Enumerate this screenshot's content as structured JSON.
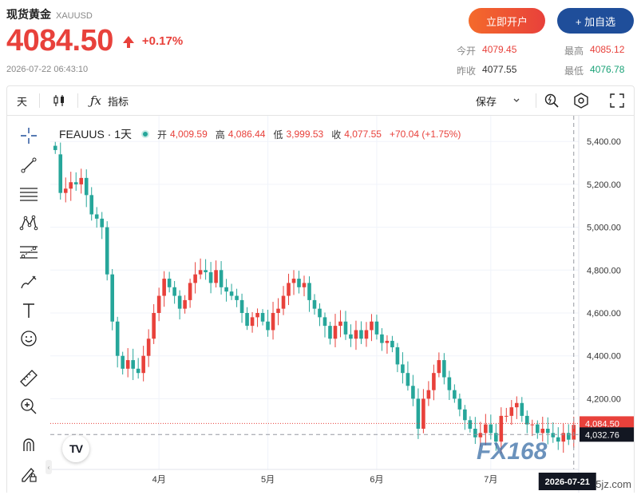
{
  "header": {
    "title": "现货黄金",
    "symbol": "XAUUSD",
    "price": "4084.50",
    "change": "+0.17%",
    "timestamp": "2026-07-22 06:43:10",
    "btn_open": "立即开户",
    "btn_watch": "+ 加自选"
  },
  "stats": {
    "open_label": "今开",
    "open_value": "4079.45",
    "high_label": "最高",
    "high_value": "4085.12",
    "prev_label": "昨收",
    "prev_value": "4077.55",
    "low_label": "最低",
    "low_value": "4076.78"
  },
  "toolbar": {
    "interval": "天",
    "indicators": "指标",
    "save": "保存"
  },
  "legend": {
    "symbol": "FEAUUS · 1天",
    "open_k": "开",
    "open_v": "4,009.59",
    "high_k": "高",
    "high_v": "4,086.44",
    "low_k": "低",
    "low_v": "3,999.53",
    "close_k": "收",
    "close_v": "4,077.55",
    "change_v": "+70.04 (+1.75%)"
  },
  "watermark": {
    "brand": "FX168",
    "url": "www.365jz.com"
  },
  "colors": {
    "up": "#e8413b",
    "down": "#26a69a",
    "accent_blue": "#1f4e9a"
  },
  "chart_data": {
    "type": "candlestick",
    "y_ticks": [
      "5,400.00",
      "5,200.00",
      "5,000.00",
      "4,800.00",
      "4,600.00",
      "4,400.00",
      "4,200.00"
    ],
    "y_tick_values": [
      5400,
      5200,
      5000,
      4800,
      4600,
      4400,
      4200
    ],
    "ylim": [
      3870,
      5520
    ],
    "x_ticks": [
      "4月",
      "5月",
      "6月",
      "7月"
    ],
    "x_tick_index": [
      20,
      41,
      62,
      84
    ],
    "last_price_label": "4,084.50",
    "last_price": 4084.5,
    "crosshair_price_label": "4,032.76",
    "crosshair_price": 4032.76,
    "crosshair_date_label": "2026-07-21",
    "crosshair_index": 100,
    "closes": [
      5360,
      5160,
      5180,
      5210,
      5200,
      5230,
      5150,
      5060,
      5040,
      5000,
      4780,
      4560,
      4400,
      4340,
      4380,
      4340,
      4320,
      4400,
      4480,
      4600,
      4680,
      4760,
      4720,
      4680,
      4620,
      4660,
      4740,
      4780,
      4800,
      4790,
      4740,
      4800,
      4720,
      4700,
      4680,
      4660,
      4600,
      4540,
      4580,
      4600,
      4560,
      4520,
      4600,
      4620,
      4680,
      4740,
      4760,
      4720,
      4740,
      4660,
      4620,
      4580,
      4540,
      4480,
      4540,
      4560,
      4500,
      4480,
      4520,
      4480,
      4520,
      4560,
      4500,
      4460,
      4470,
      4440,
      4360,
      4320,
      4260,
      4200,
      4060,
      4200,
      4240,
      4320,
      4380,
      4300,
      4240,
      4200,
      4150,
      4100,
      4060,
      4020,
      4040,
      4080,
      4040,
      4000,
      4120,
      4120,
      4160,
      4180,
      4120,
      4080,
      4080,
      4040,
      4060,
      4040,
      4020,
      4000,
      4040,
      4009,
      4078
    ],
    "opens": [
      5380,
      5340,
      5160,
      5180,
      5210,
      5200,
      5230,
      5150,
      5060,
      5040,
      5000,
      4780,
      4560,
      4400,
      4340,
      4380,
      4340,
      4320,
      4400,
      4480,
      4600,
      4680,
      4760,
      4720,
      4680,
      4620,
      4660,
      4740,
      4780,
      4800,
      4790,
      4740,
      4800,
      4720,
      4700,
      4680,
      4660,
      4600,
      4540,
      4580,
      4600,
      4560,
      4520,
      4600,
      4620,
      4680,
      4740,
      4760,
      4720,
      4740,
      4660,
      4620,
      4580,
      4540,
      4480,
      4540,
      4560,
      4500,
      4480,
      4520,
      4480,
      4520,
      4560,
      4500,
      4460,
      4470,
      4440,
      4360,
      4320,
      4260,
      4200,
      4060,
      4200,
      4240,
      4320,
      4380,
      4300,
      4240,
      4200,
      4150,
      4100,
      4060,
      4020,
      4040,
      4080,
      4040,
      4000,
      4120,
      4120,
      4160,
      4180,
      4120,
      4080,
      4080,
      4040,
      4060,
      4040,
      4020,
      4000,
      4040,
      4009
    ]
  }
}
